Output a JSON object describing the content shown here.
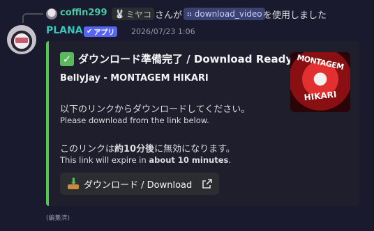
{
  "reply": {
    "username": "coffin299",
    "tag": "ミヤコ",
    "text_before": "さんが",
    "command": "download_video",
    "text_after": "を使用しました"
  },
  "message": {
    "username": "PLANA",
    "badge": "アプリ",
    "timestamp": "2026/07/23 1:06",
    "edited": "(編集済)"
  },
  "embed": {
    "title": "ダウンロード準備完了 / Download Ready",
    "subtitle": "BellyJay - MONTAGEM HIKARI",
    "line1": "以下のリンクからダウンロードしてください。",
    "line2": "Please download from the link below.",
    "line3_pre": "このリンクは",
    "line3_bold": "約10分後",
    "line3_post": "に無効になります。",
    "line4_pre": "This link will expire in ",
    "line4_bold": "about 10 minutes",
    "line4_post": ".",
    "thumbnail_text1": "MONTAGEM",
    "thumbnail_text2": "HIKARI",
    "accent_color": "#4fc94f",
    "button_label": "ダウンロード / Download"
  }
}
